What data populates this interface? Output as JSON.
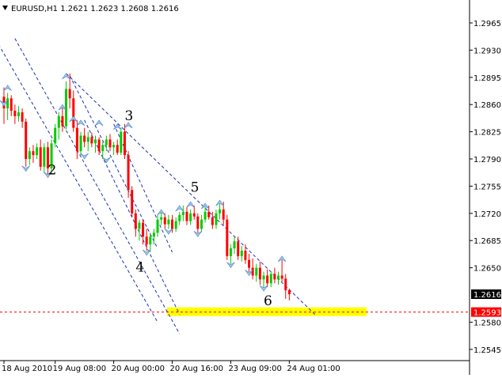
{
  "chart_data": {
    "type": "candlestick",
    "title": "EURUSD,H1  1.2621 1.2623 1.2608 1.2616",
    "ylim": [
      1.2545,
      1.297
    ],
    "y_ticks": [
      "1.2965",
      "1.2930",
      "1.2895",
      "1.2860",
      "1.2825",
      "1.2790",
      "1.2755",
      "1.2720",
      "1.2685",
      "1.2650",
      "1.2580",
      "1.2545"
    ],
    "x_ticks": [
      {
        "label": "18 Aug 2010",
        "index": 0
      },
      {
        "label": "19 Aug 08:00",
        "index": 14
      },
      {
        "label": "20 Aug 00:00",
        "index": 30
      },
      {
        "label": "20 Aug 16:00",
        "index": 46
      },
      {
        "label": "23 Aug 09:00",
        "index": 62
      },
      {
        "label": "24 Aug 01:00",
        "index": 78
      }
    ],
    "current_price": {
      "value": 1.2616,
      "label": "1.2616"
    },
    "target_level": {
      "value": 1.2593,
      "label": "1.2593",
      "color": "#ff0000"
    },
    "target_zone": {
      "value": 1.2593,
      "color": "#ffff00"
    },
    "bull_color": "#00cc00",
    "bear_color": "#ff0000",
    "candles": [
      [
        1.287,
        1.2882,
        1.2835,
        1.2855
      ],
      [
        1.2855,
        1.2875,
        1.284,
        1.2868
      ],
      [
        1.2868,
        1.2872,
        1.2845,
        1.2852
      ],
      [
        1.2852,
        1.286,
        1.2835,
        1.2845
      ],
      [
        1.2845,
        1.2858,
        1.2838,
        1.285
      ],
      [
        1.285,
        1.2855,
        1.283,
        1.2838
      ],
      [
        1.2838,
        1.2842,
        1.278,
        1.279
      ],
      [
        1.279,
        1.2805,
        1.2782,
        1.28
      ],
      [
        1.28,
        1.2808,
        1.2785,
        1.2795
      ],
      [
        1.2795,
        1.281,
        1.279,
        1.2805
      ],
      [
        1.2805,
        1.2815,
        1.2775,
        1.278
      ],
      [
        1.278,
        1.281,
        1.2772,
        1.2805
      ],
      [
        1.2805,
        1.2812,
        1.277,
        1.2778
      ],
      [
        1.2778,
        1.2815,
        1.277,
        1.281
      ],
      [
        1.281,
        1.2835,
        1.2805,
        1.283
      ],
      [
        1.283,
        1.285,
        1.2815,
        1.2845
      ],
      [
        1.2845,
        1.2858,
        1.2825,
        1.2832
      ],
      [
        1.2832,
        1.289,
        1.2828,
        1.288
      ],
      [
        1.288,
        1.29,
        1.2855,
        1.2868
      ],
      [
        1.2868,
        1.2878,
        1.2825,
        1.283
      ],
      [
        1.283,
        1.284,
        1.279,
        1.28
      ],
      [
        1.28,
        1.2825,
        1.2795,
        1.282
      ],
      [
        1.282,
        1.283,
        1.2805,
        1.2812
      ],
      [
        1.2812,
        1.2825,
        1.28,
        1.2818
      ],
      [
        1.2818,
        1.2824,
        1.2805,
        1.281
      ],
      [
        1.281,
        1.282,
        1.2798,
        1.2815
      ],
      [
        1.2815,
        1.2818,
        1.2795,
        1.28
      ],
      [
        1.28,
        1.2812,
        1.279,
        1.2808
      ],
      [
        1.2808,
        1.282,
        1.28,
        1.2815
      ],
      [
        1.2815,
        1.2822,
        1.28,
        1.2805
      ],
      [
        1.2805,
        1.2812,
        1.2795,
        1.2808
      ],
      [
        1.2808,
        1.2815,
        1.2795,
        1.2798
      ],
      [
        1.2798,
        1.283,
        1.2795,
        1.2825
      ],
      [
        1.2825,
        1.2835,
        1.279,
        1.2795
      ],
      [
        1.2795,
        1.28,
        1.274,
        1.275
      ],
      [
        1.275,
        1.2755,
        1.2715,
        1.272
      ],
      [
        1.272,
        1.2725,
        1.269,
        1.27
      ],
      [
        1.27,
        1.2712,
        1.2685,
        1.2708
      ],
      [
        1.2708,
        1.2712,
        1.268,
        1.269
      ],
      [
        1.269,
        1.27,
        1.2672,
        1.268
      ],
      [
        1.268,
        1.2695,
        1.267,
        1.269
      ],
      [
        1.269,
        1.27,
        1.268,
        1.2695
      ],
      [
        1.2695,
        1.2718,
        1.269,
        1.2712
      ],
      [
        1.2712,
        1.2722,
        1.2705,
        1.2715
      ],
      [
        1.2715,
        1.272,
        1.27,
        1.2706
      ],
      [
        1.2706,
        1.2718,
        1.27,
        1.2712
      ],
      [
        1.2712,
        1.2718,
        1.2695,
        1.27
      ],
      [
        1.27,
        1.2715,
        1.2696,
        1.271
      ],
      [
        1.271,
        1.2722,
        1.2705,
        1.2718
      ],
      [
        1.2718,
        1.273,
        1.271,
        1.2722
      ],
      [
        1.2722,
        1.2728,
        1.2705,
        1.271
      ],
      [
        1.271,
        1.2725,
        1.2705,
        1.272
      ],
      [
        1.272,
        1.273,
        1.2712,
        1.2716
      ],
      [
        1.2716,
        1.272,
        1.2695,
        1.27
      ],
      [
        1.27,
        1.2718,
        1.2696,
        1.2712
      ],
      [
        1.2712,
        1.2728,
        1.2708,
        1.2722
      ],
      [
        1.2722,
        1.273,
        1.2712,
        1.2715
      ],
      [
        1.2715,
        1.2722,
        1.27,
        1.2705
      ],
      [
        1.2705,
        1.2725,
        1.27,
        1.272
      ],
      [
        1.272,
        1.2732,
        1.2712,
        1.2725
      ],
      [
        1.2725,
        1.2735,
        1.2705,
        1.2712
      ],
      [
        1.2712,
        1.2718,
        1.266,
        1.2665
      ],
      [
        1.2665,
        1.268,
        1.2655,
        1.2675
      ],
      [
        1.2675,
        1.269,
        1.2668,
        1.2684
      ],
      [
        1.2684,
        1.269,
        1.266,
        1.2665
      ],
      [
        1.2665,
        1.2678,
        1.2658,
        1.2672
      ],
      [
        1.2672,
        1.268,
        1.2655,
        1.266
      ],
      [
        1.266,
        1.2668,
        1.2645,
        1.265
      ],
      [
        1.265,
        1.2662,
        1.2635,
        1.264
      ],
      [
        1.264,
        1.2655,
        1.2632,
        1.265
      ],
      [
        1.265,
        1.2658,
        1.2628,
        1.2635
      ],
      [
        1.2635,
        1.2645,
        1.2622,
        1.264
      ],
      [
        1.264,
        1.2648,
        1.2625,
        1.263
      ],
      [
        1.263,
        1.2645,
        1.2625,
        1.2642
      ],
      [
        1.2642,
        1.265,
        1.263,
        1.2635
      ],
      [
        1.2635,
        1.2645,
        1.2628,
        1.264
      ],
      [
        1.264,
        1.266,
        1.2632,
        1.2636
      ],
      [
        1.2636,
        1.2642,
        1.261,
        1.2621
      ],
      [
        1.2621,
        1.2623,
        1.2608,
        1.2616
      ]
    ],
    "fractals_up": [
      [
        1,
        1.2885
      ],
      [
        16,
        1.286
      ],
      [
        17,
        1.29
      ],
      [
        19,
        1.2845
      ],
      [
        21,
        1.284
      ],
      [
        26,
        1.284
      ],
      [
        31,
        1.2835
      ],
      [
        34,
        1.2837
      ],
      [
        43,
        1.2725
      ],
      [
        48,
        1.273
      ],
      [
        51,
        1.2735
      ],
      [
        55,
        1.2733
      ],
      [
        59,
        1.2737
      ],
      [
        76,
        1.2665
      ]
    ],
    "fractals_down": [
      [
        0,
        1.2858
      ],
      [
        6,
        1.2774
      ],
      [
        12,
        1.2766
      ],
      [
        22,
        1.279
      ],
      [
        28,
        1.2785
      ],
      [
        39,
        1.2666
      ],
      [
        45,
        1.2693
      ],
      [
        53,
        1.269
      ],
      [
        62,
        1.265
      ],
      [
        67,
        1.264
      ],
      [
        71,
        1.262
      ]
    ],
    "trend_lines": [
      {
        "from": [
          -3,
          1.295
        ],
        "to": [
          42,
          1.258
        ]
      },
      {
        "from": [
          3,
          1.2945
        ],
        "to": [
          48,
          1.2565
        ]
      },
      {
        "from": [
          17,
          1.29
        ],
        "to": [
          85,
          1.259
        ]
      },
      {
        "from": [
          18,
          1.2897
        ],
        "to": [
          42,
          1.2675
        ]
      },
      {
        "from": [
          22,
          1.284
        ],
        "to": [
          48,
          1.259
        ]
      },
      {
        "from": [
          30,
          1.2835
        ],
        "to": [
          46,
          1.267
        ]
      }
    ],
    "wave_labels": [
      {
        "text": "2",
        "index": 12,
        "price": 1.277
      },
      {
        "text": "3",
        "index": 33,
        "price": 1.284
      },
      {
        "text": "4",
        "index": 36,
        "price": 1.2645
      },
      {
        "text": "5",
        "index": 51,
        "price": 1.2748
      },
      {
        "text": "6",
        "index": 71,
        "price": 1.2602
      }
    ]
  }
}
